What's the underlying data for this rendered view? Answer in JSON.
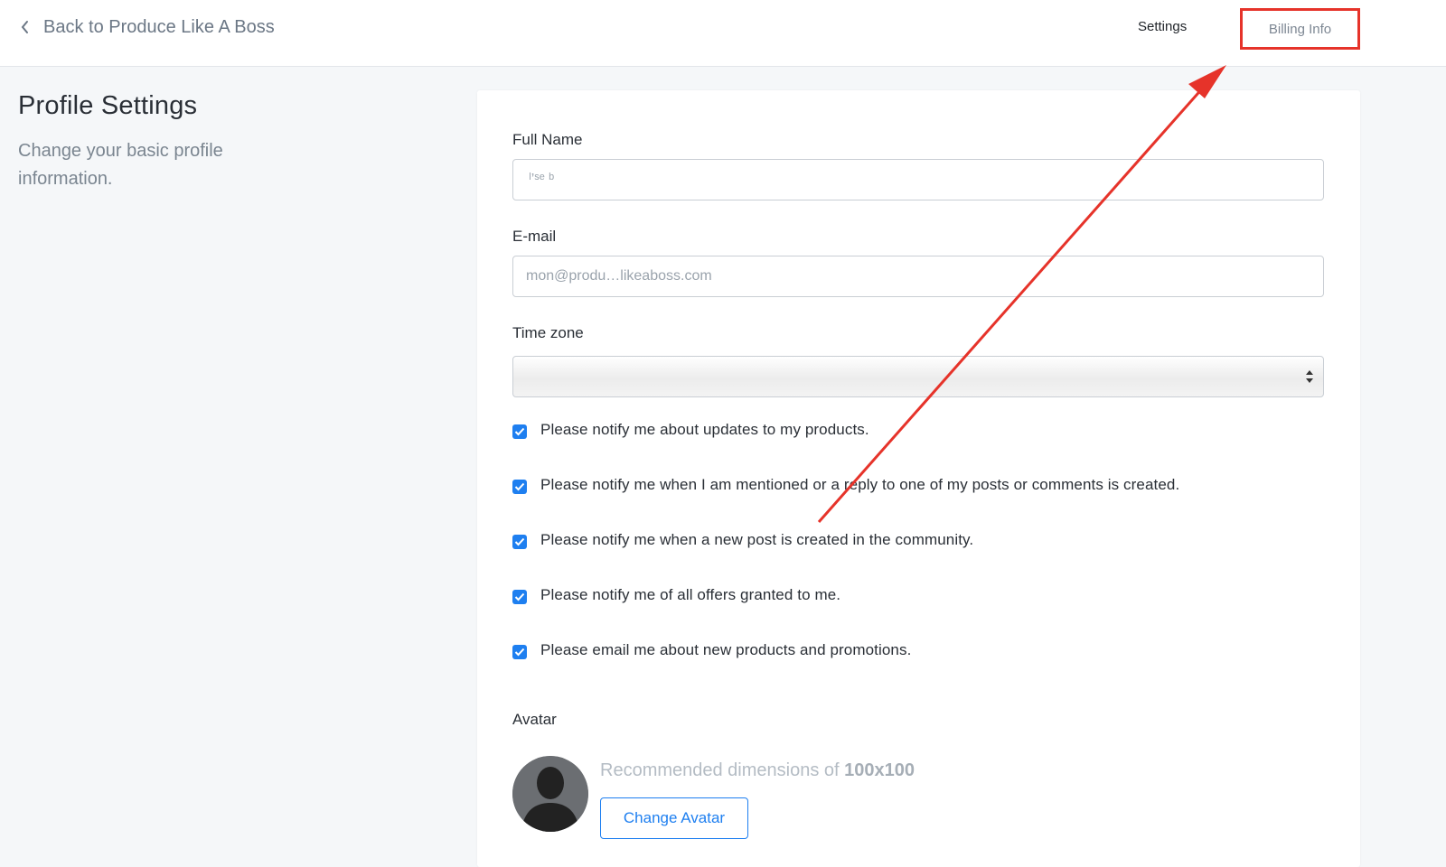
{
  "header": {
    "back_label": "Back to Produce Like A Boss",
    "nav_settings": "Settings",
    "nav_billing": "Billing Info"
  },
  "sidebar": {
    "title": "Profile Settings",
    "subtitle": "Change your basic profile information."
  },
  "form": {
    "full_name_label": "Full Name",
    "full_name_value": " ˡ’ˢᵉ ᵇ",
    "email_label": "E-mail",
    "email_value": "mon@produ…likeaboss.com",
    "timezone_label": "Time zone",
    "timezone_value": "",
    "checkboxes": [
      {
        "label": "Please notify me about updates to my products.",
        "checked": true
      },
      {
        "label": "Please notify me when I am mentioned or a reply to one of my posts or comments is created.",
        "checked": true
      },
      {
        "label": "Please notify me when a new post is created in the community.",
        "checked": true
      },
      {
        "label": "Please notify me of all offers granted to me.",
        "checked": true
      },
      {
        "label": "Please email me about new products and promotions.",
        "checked": true
      }
    ],
    "avatar_label": "Avatar",
    "avatar_hint": "Recommended dimensions of ",
    "avatar_hint_dims": "100x100",
    "change_avatar_label": "Change Avatar"
  },
  "colors": {
    "accent": "#1e7ff0",
    "annotation": "#e6332a",
    "background": "#f5f7f9"
  }
}
